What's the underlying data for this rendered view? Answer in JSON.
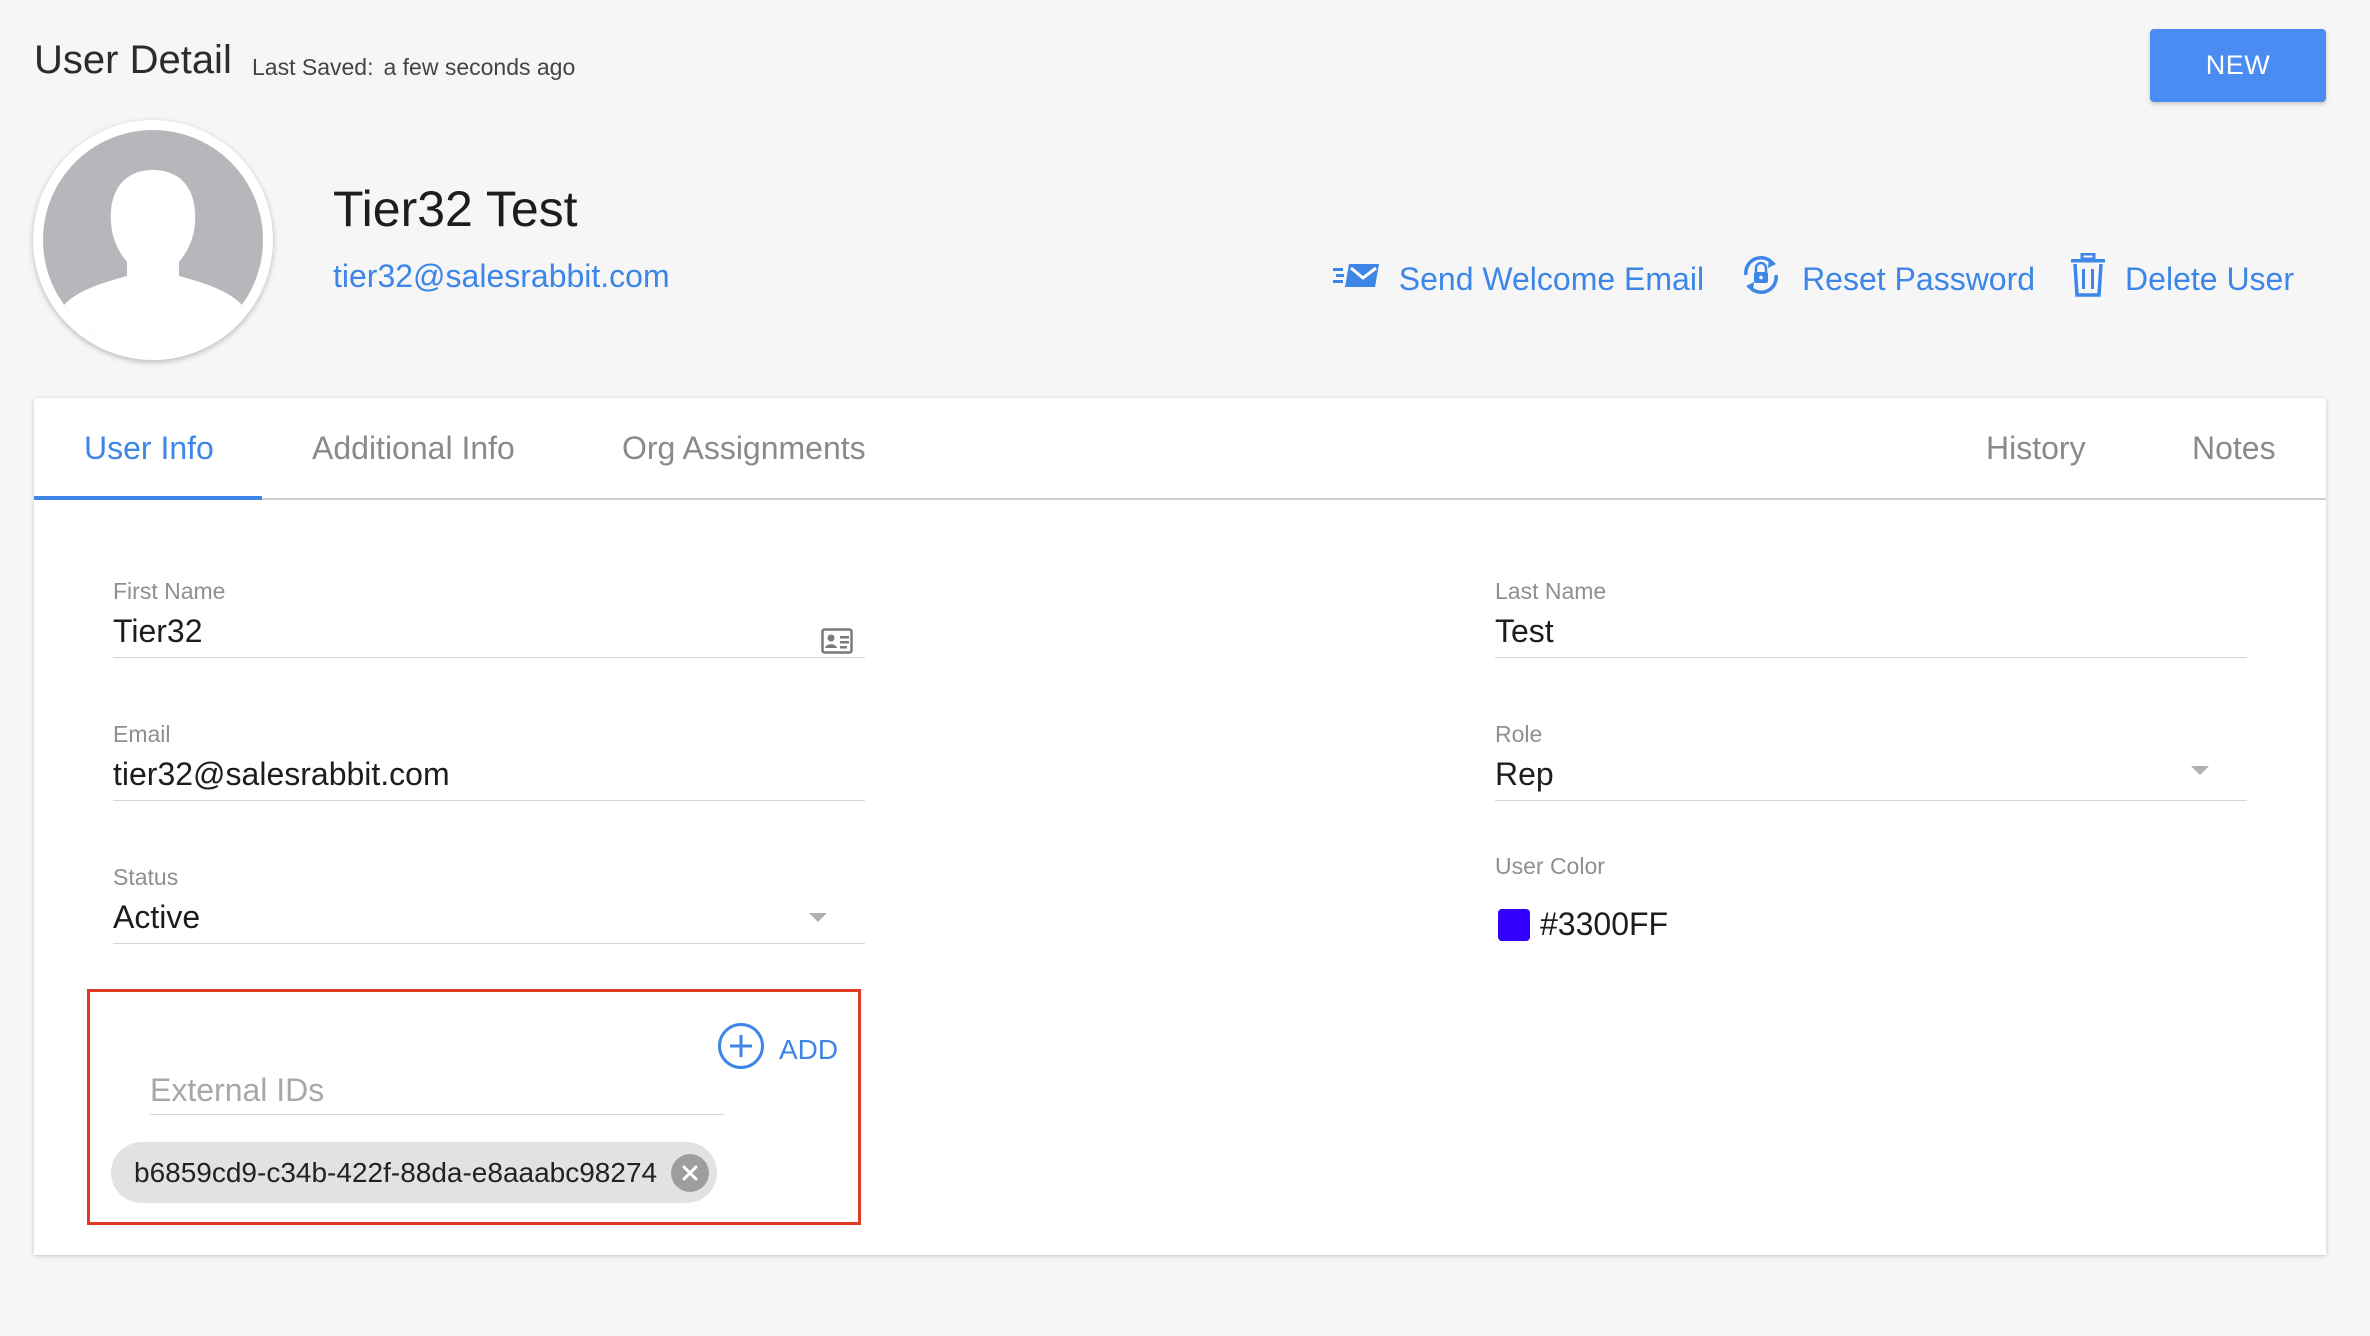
{
  "header": {
    "title": "User Detail",
    "last_saved_label": "Last Saved:",
    "last_saved_value": "a few seconds ago",
    "new_button": "NEW"
  },
  "user": {
    "name": "Tier32 Test",
    "email": "tier32@salesrabbit.com"
  },
  "actions": {
    "send_welcome": "Send Welcome Email",
    "reset_password": "Reset Password",
    "delete_user": "Delete User"
  },
  "tabs": {
    "user_info": "User Info",
    "additional_info": "Additional Info",
    "org_assignments": "Org Assignments",
    "history": "History",
    "notes": "Notes"
  },
  "form": {
    "first_name_label": "First Name",
    "first_name_value": "Tier32",
    "last_name_label": "Last Name",
    "last_name_value": "Test",
    "email_label": "Email",
    "email_value": "tier32@salesrabbit.com",
    "role_label": "Role",
    "role_value": "Rep",
    "status_label": "Status",
    "status_value": "Active",
    "user_color_label": "User Color",
    "user_color_value": "#3300FF",
    "external_ids_placeholder": "External IDs",
    "add_label": "ADD",
    "external_ids": [
      "b6859cd9-c34b-422f-88da-e8aaabc98274"
    ]
  },
  "colors": {
    "accent": "#3d86e8",
    "primary_button": "#4a8cf1",
    "highlight_border": "#e03a25",
    "user_color_swatch": "#3300FF"
  },
  "icons": {
    "send_welcome": "email-send-icon",
    "reset_password": "lock-reset-icon",
    "delete_user": "trash-icon",
    "first_name_field": "id-card-icon",
    "add": "plus-circle-icon",
    "chip_remove": "close-icon"
  }
}
